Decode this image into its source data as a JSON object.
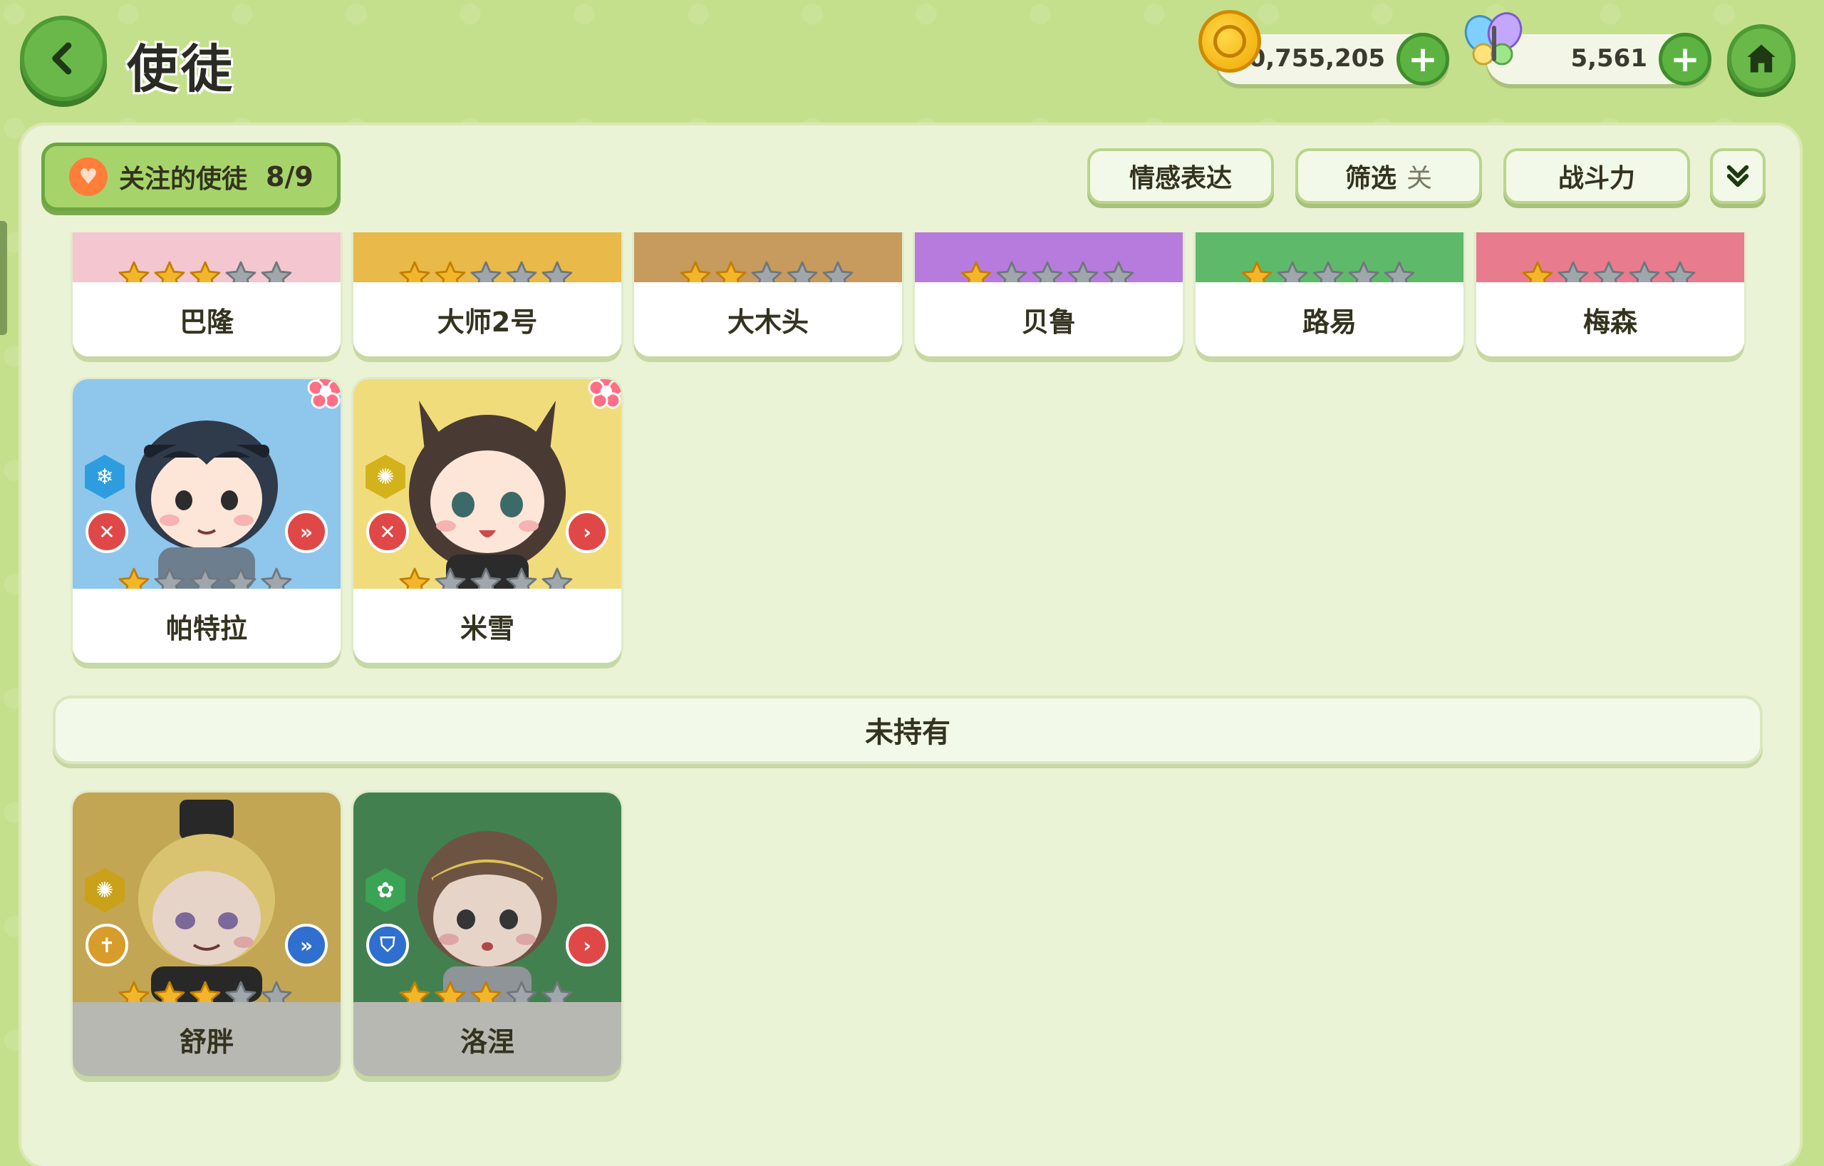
{
  "header": {
    "title": "使徒",
    "gold": "10,755,205",
    "gems": "5,561"
  },
  "toolbar": {
    "follow_label": "关注的使徒",
    "follow_count": "8/9",
    "emotion_label": "情感表达",
    "filter_label": "筛选",
    "filter_state": "关",
    "sort_label": "战斗力"
  },
  "owned_top_row": [
    {
      "name": "巴隆",
      "stars": 3,
      "bg": "#f4c6cf"
    },
    {
      "name": "大师2号",
      "stars": 2,
      "bg": "#e9b949"
    },
    {
      "name": "大木头",
      "stars": 2,
      "bg": "#c79a5e"
    },
    {
      "name": "贝鲁",
      "stars": 1,
      "bg": "#b77bde"
    },
    {
      "name": "路易",
      "stars": 1,
      "bg": "#5fb96a"
    },
    {
      "name": "梅森",
      "stars": 1,
      "bg": "#e97b8e"
    }
  ],
  "owned_second_row": [
    {
      "name": "帕特拉",
      "stars": 1,
      "bg": "#8ec6ec",
      "element": "ice-icon",
      "role": "crossed-swords-icon"
    },
    {
      "name": "米雪",
      "stars": 1,
      "bg": "#f1dc7c",
      "element": "sun-icon",
      "role": "crossed-swords-icon"
    }
  ],
  "unowned_section": {
    "label": "未持有",
    "items": [
      {
        "name": "舒胖",
        "stars": 3,
        "bg": "#d8b44a",
        "element": "sun-icon",
        "role": "cross-icon"
      },
      {
        "name": "洛涅",
        "stars": 3,
        "bg": "#3f8f4f",
        "element": "leaf-icon",
        "role": "shield-icon"
      }
    ]
  },
  "colors": {
    "accent_green": "#6bb84a",
    "panel": "#eaf3d6",
    "background": "#c5e08c"
  }
}
